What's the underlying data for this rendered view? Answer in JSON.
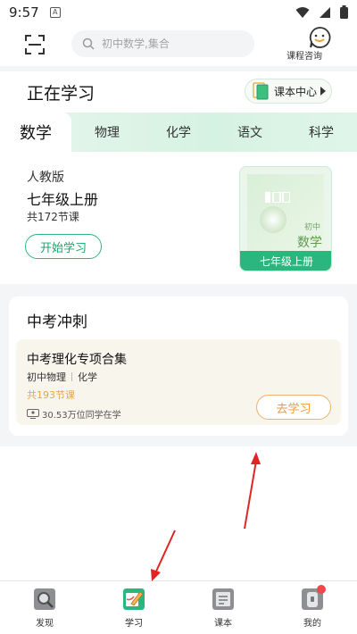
{
  "status_bar": {
    "time": "9:57",
    "a_glyph": "A"
  },
  "header": {
    "search_placeholder": "初中数学,集合",
    "consult_label": "课程咨询"
  },
  "learning": {
    "title": "正在学习",
    "textbook_center_label": "课本中心"
  },
  "tabs": [
    {
      "label": "数学",
      "active": true
    },
    {
      "label": "物理",
      "active": false
    },
    {
      "label": "化学",
      "active": false
    },
    {
      "label": "语文",
      "active": false
    },
    {
      "label": "科学",
      "active": false
    }
  ],
  "current_course": {
    "edition": "人教版",
    "grade": "七年级上册",
    "lesson_count": "共172节课",
    "start_button": "开始学习",
    "cover": {
      "tag": "初中",
      "subject": "数学",
      "band_label": "七年级上册"
    }
  },
  "exam": {
    "section_title": "中考冲刺",
    "item": {
      "title": "中考理化专项合集",
      "tags": [
        "初中物理",
        "化学"
      ],
      "lesson_count": "共193节课",
      "learners": "30.53万位同学在学",
      "button": "去学习"
    }
  },
  "bottom_nav": [
    {
      "label": "发现",
      "icon": "magnifier-icon"
    },
    {
      "label": "学习",
      "icon": "pencil-book-icon",
      "active": true
    },
    {
      "label": "课本",
      "icon": "textbook-icon"
    },
    {
      "label": "我的",
      "icon": "profile-icon",
      "badge": true
    }
  ],
  "colors": {
    "brand_green": "#2bb67e",
    "accent_orange": "#ee9a3a",
    "arrow_red": "#e02424"
  }
}
